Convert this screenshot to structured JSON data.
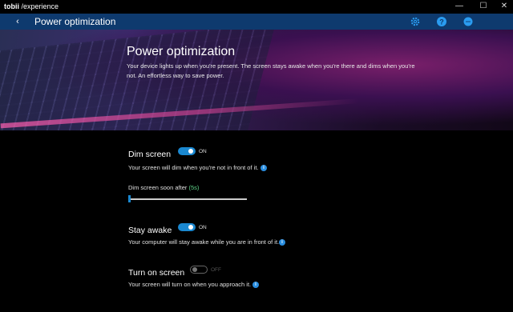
{
  "app": {
    "brand_bold": "tobii",
    "brand_rest": " /experience"
  },
  "window": {
    "minimize": "—",
    "maximize": "☐",
    "close": "✕"
  },
  "nav": {
    "back": "‹",
    "title": "Power optimization"
  },
  "icons": {
    "settings": "gear-icon",
    "help": "help-icon",
    "feedback": "chat-icon"
  },
  "hero": {
    "title": "Power optimization",
    "description": "Your device lights up when you're present. The screen stays awake when you're there and dims when you're not. An effortless way to save power."
  },
  "dim_screen": {
    "title": "Dim screen",
    "toggle_state": "ON",
    "description": "Your screen will dim when you're not in front of it.",
    "slider_label": "Dim screen soon after",
    "slider_value": "(5s)"
  },
  "stay_awake": {
    "title": "Stay awake",
    "toggle_state": "ON",
    "description": "Your computer will stay awake while you are in front of it."
  },
  "turn_on_screen": {
    "title": "Turn on screen",
    "toggle_state": "OFF",
    "description": "Your screen will turn on when you approach it."
  },
  "colors": {
    "accent": "#1a88d0",
    "navbar": "#0e3a6e",
    "slider_value": "#5fd58a"
  }
}
